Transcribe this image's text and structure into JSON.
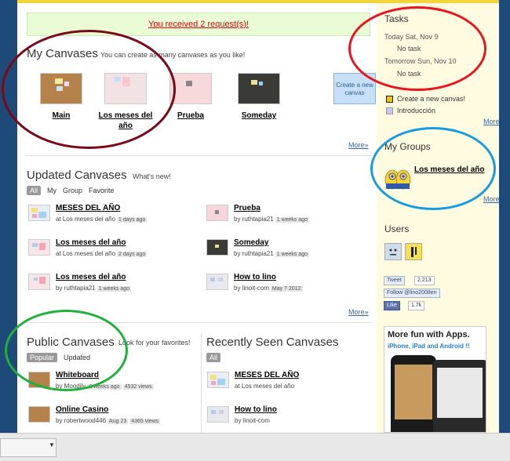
{
  "notice": "You received 2 request(s)!",
  "my_canvases": {
    "title": "My Canvases",
    "subtitle": "You can create as many canvases as you like!",
    "items": [
      {
        "label": "Main"
      },
      {
        "label": "Los meses del año"
      },
      {
        "label": "Prueba"
      },
      {
        "label": "Someday"
      }
    ],
    "create_label": "Create a new canvas",
    "more": "More»"
  },
  "updated": {
    "title": "Updated Canvases",
    "subtitle": "What's new!",
    "filters": [
      "All",
      "My",
      "Group",
      "Favorite"
    ],
    "rows": [
      {
        "title": "MESES DEL AÑO",
        "meta": "at Los meses del año",
        "time": "1 days ago"
      },
      {
        "title": "Prueba",
        "meta": "by ruthtapia21",
        "time": "1 weeks ago"
      },
      {
        "title": "Los meses del año",
        "meta": "at Los meses del año",
        "time": "2 days ago"
      },
      {
        "title": "Someday",
        "meta": "by ruthtapia21",
        "time": "1 weeks ago"
      },
      {
        "title": "Los meses del año",
        "meta": "by ruthtapia21",
        "time": "1 weeks ago"
      },
      {
        "title": "How to lino",
        "meta": "by linoit-com",
        "time": "May 7 2012"
      }
    ],
    "more": "More»"
  },
  "public": {
    "title": "Public Canvases",
    "subtitle": "Look for your favorites!",
    "filters": [
      "Popular",
      "Updated"
    ],
    "rows": [
      {
        "title": "Whiteboard",
        "meta": "by Moodily",
        "time": "2 weeks ago",
        "views": "4532 views"
      },
      {
        "title": "Online Casino",
        "meta": "by robertwood446",
        "time": "Aug 23",
        "views": "4365 views"
      }
    ]
  },
  "recent": {
    "title": "Recently Seen Canvases",
    "filters": [
      "All"
    ],
    "rows": [
      {
        "title": "MESES DEL AÑO",
        "meta": "at Los meses del año"
      },
      {
        "title": "How to lino",
        "meta": "by linoit-com"
      }
    ]
  },
  "tasks": {
    "title": "Tasks",
    "today": "Today Sat, Nov 9",
    "today_task": "No task",
    "tomorrow": "Tomorrow Sun, Nov 10",
    "tomorrow_task": "No task",
    "links": [
      "Create a new canvas!",
      "Introducción"
    ],
    "more": "More»"
  },
  "groups": {
    "title": "My Groups",
    "item": "Los meses del año",
    "more": "More»"
  },
  "users": {
    "title": "Users"
  },
  "social": {
    "tweet": "Tweet",
    "tweet_count": "2,213",
    "follow": "Follow @lino2008en",
    "like": "Like",
    "like_count": "1.7k"
  },
  "ad": {
    "headline": "More fun with Apps.",
    "subline": "iPhone, iPad and Android !!"
  },
  "colors": {
    "annotation_red_dark": "#7a0a1a",
    "annotation_red": "#e8141e",
    "annotation_blue": "#1a9be0",
    "annotation_green": "#22b03a",
    "notice_text": "#e30000"
  }
}
